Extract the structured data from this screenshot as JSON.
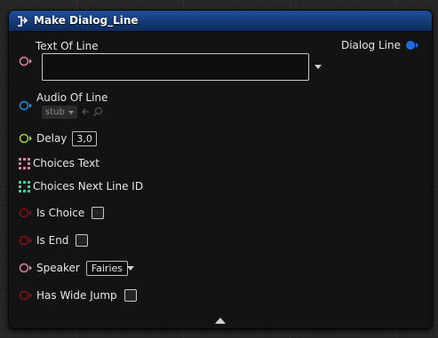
{
  "node": {
    "title": "Make Dialog_Line",
    "header_color": "#1a4590",
    "header_icon": "struct-make-icon",
    "output": {
      "label": "Dialog Line",
      "pin_color": "#1e6ee6",
      "pin_icon": "struct-output-pin-icon"
    },
    "inputs": {
      "text_of_line": {
        "label": "Text Of Line",
        "value": "",
        "pin_color": "#e07fa3"
      },
      "audio_of_line": {
        "label": "Audio Of Line",
        "asset_value": "stub",
        "pin_color": "#1c8fe0"
      },
      "delay": {
        "label": "Delay",
        "value": "3,0",
        "pin_color": "#9bd43a"
      },
      "choices_text": {
        "label": "Choices Text",
        "pin_color": "#e07fa3"
      },
      "choices_next_line_id": {
        "label": "Choices Next Line ID",
        "pin_color": "#2fd69b"
      },
      "is_choice": {
        "label": "Is Choice",
        "checked": false,
        "pin_color": "#8b0f0f"
      },
      "is_end": {
        "label": "Is End",
        "checked": false,
        "pin_color": "#8b0f0f"
      },
      "speaker": {
        "label": "Speaker",
        "value": "Fairies",
        "pin_color": "#e07fa3"
      },
      "has_wide_jump": {
        "label": "Has Wide Jump",
        "checked": false,
        "pin_color": "#8b0f0f"
      }
    },
    "advanced_toggle_icon": "collapse-up-arrow-icon"
  }
}
